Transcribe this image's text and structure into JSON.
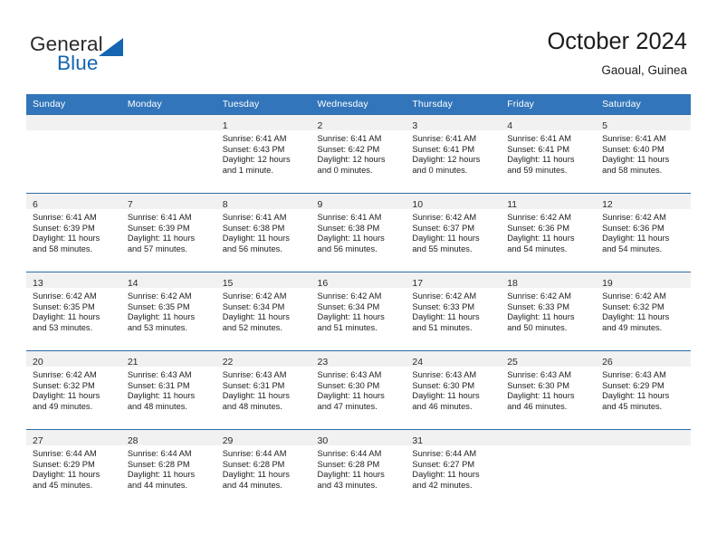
{
  "brand": {
    "name_part1": "General",
    "name_part2": "Blue",
    "accent_color": "#1565b0"
  },
  "header": {
    "title": "October 2024",
    "subtitle": "Gaoual, Guinea"
  },
  "calendar": {
    "header_bg": "#3275ba",
    "row_divider_color": "#2e6da4",
    "daynum_band_bg": "#f1f1f1",
    "weekday_headers": [
      "Sunday",
      "Monday",
      "Tuesday",
      "Wednesday",
      "Thursday",
      "Friday",
      "Saturday"
    ],
    "weeks": [
      [
        {
          "day": "",
          "empty": true
        },
        {
          "day": "",
          "empty": true
        },
        {
          "day": "1",
          "sunrise": "Sunrise: 6:41 AM",
          "sunset": "Sunset: 6:43 PM",
          "daylight_line1": "Daylight: 12 hours",
          "daylight_line2": "and 1 minute."
        },
        {
          "day": "2",
          "sunrise": "Sunrise: 6:41 AM",
          "sunset": "Sunset: 6:42 PM",
          "daylight_line1": "Daylight: 12 hours",
          "daylight_line2": "and 0 minutes."
        },
        {
          "day": "3",
          "sunrise": "Sunrise: 6:41 AM",
          "sunset": "Sunset: 6:41 PM",
          "daylight_line1": "Daylight: 12 hours",
          "daylight_line2": "and 0 minutes."
        },
        {
          "day": "4",
          "sunrise": "Sunrise: 6:41 AM",
          "sunset": "Sunset: 6:41 PM",
          "daylight_line1": "Daylight: 11 hours",
          "daylight_line2": "and 59 minutes."
        },
        {
          "day": "5",
          "sunrise": "Sunrise: 6:41 AM",
          "sunset": "Sunset: 6:40 PM",
          "daylight_line1": "Daylight: 11 hours",
          "daylight_line2": "and 58 minutes."
        }
      ],
      [
        {
          "day": "6",
          "sunrise": "Sunrise: 6:41 AM",
          "sunset": "Sunset: 6:39 PM",
          "daylight_line1": "Daylight: 11 hours",
          "daylight_line2": "and 58 minutes."
        },
        {
          "day": "7",
          "sunrise": "Sunrise: 6:41 AM",
          "sunset": "Sunset: 6:39 PM",
          "daylight_line1": "Daylight: 11 hours",
          "daylight_line2": "and 57 minutes."
        },
        {
          "day": "8",
          "sunrise": "Sunrise: 6:41 AM",
          "sunset": "Sunset: 6:38 PM",
          "daylight_line1": "Daylight: 11 hours",
          "daylight_line2": "and 56 minutes."
        },
        {
          "day": "9",
          "sunrise": "Sunrise: 6:41 AM",
          "sunset": "Sunset: 6:38 PM",
          "daylight_line1": "Daylight: 11 hours",
          "daylight_line2": "and 56 minutes."
        },
        {
          "day": "10",
          "sunrise": "Sunrise: 6:42 AM",
          "sunset": "Sunset: 6:37 PM",
          "daylight_line1": "Daylight: 11 hours",
          "daylight_line2": "and 55 minutes."
        },
        {
          "day": "11",
          "sunrise": "Sunrise: 6:42 AM",
          "sunset": "Sunset: 6:36 PM",
          "daylight_line1": "Daylight: 11 hours",
          "daylight_line2": "and 54 minutes."
        },
        {
          "day": "12",
          "sunrise": "Sunrise: 6:42 AM",
          "sunset": "Sunset: 6:36 PM",
          "daylight_line1": "Daylight: 11 hours",
          "daylight_line2": "and 54 minutes."
        }
      ],
      [
        {
          "day": "13",
          "sunrise": "Sunrise: 6:42 AM",
          "sunset": "Sunset: 6:35 PM",
          "daylight_line1": "Daylight: 11 hours",
          "daylight_line2": "and 53 minutes."
        },
        {
          "day": "14",
          "sunrise": "Sunrise: 6:42 AM",
          "sunset": "Sunset: 6:35 PM",
          "daylight_line1": "Daylight: 11 hours",
          "daylight_line2": "and 53 minutes."
        },
        {
          "day": "15",
          "sunrise": "Sunrise: 6:42 AM",
          "sunset": "Sunset: 6:34 PM",
          "daylight_line1": "Daylight: 11 hours",
          "daylight_line2": "and 52 minutes."
        },
        {
          "day": "16",
          "sunrise": "Sunrise: 6:42 AM",
          "sunset": "Sunset: 6:34 PM",
          "daylight_line1": "Daylight: 11 hours",
          "daylight_line2": "and 51 minutes."
        },
        {
          "day": "17",
          "sunrise": "Sunrise: 6:42 AM",
          "sunset": "Sunset: 6:33 PM",
          "daylight_line1": "Daylight: 11 hours",
          "daylight_line2": "and 51 minutes."
        },
        {
          "day": "18",
          "sunrise": "Sunrise: 6:42 AM",
          "sunset": "Sunset: 6:33 PM",
          "daylight_line1": "Daylight: 11 hours",
          "daylight_line2": "and 50 minutes."
        },
        {
          "day": "19",
          "sunrise": "Sunrise: 6:42 AM",
          "sunset": "Sunset: 6:32 PM",
          "daylight_line1": "Daylight: 11 hours",
          "daylight_line2": "and 49 minutes."
        }
      ],
      [
        {
          "day": "20",
          "sunrise": "Sunrise: 6:42 AM",
          "sunset": "Sunset: 6:32 PM",
          "daylight_line1": "Daylight: 11 hours",
          "daylight_line2": "and 49 minutes."
        },
        {
          "day": "21",
          "sunrise": "Sunrise: 6:43 AM",
          "sunset": "Sunset: 6:31 PM",
          "daylight_line1": "Daylight: 11 hours",
          "daylight_line2": "and 48 minutes."
        },
        {
          "day": "22",
          "sunrise": "Sunrise: 6:43 AM",
          "sunset": "Sunset: 6:31 PM",
          "daylight_line1": "Daylight: 11 hours",
          "daylight_line2": "and 48 minutes."
        },
        {
          "day": "23",
          "sunrise": "Sunrise: 6:43 AM",
          "sunset": "Sunset: 6:30 PM",
          "daylight_line1": "Daylight: 11 hours",
          "daylight_line2": "and 47 minutes."
        },
        {
          "day": "24",
          "sunrise": "Sunrise: 6:43 AM",
          "sunset": "Sunset: 6:30 PM",
          "daylight_line1": "Daylight: 11 hours",
          "daylight_line2": "and 46 minutes."
        },
        {
          "day": "25",
          "sunrise": "Sunrise: 6:43 AM",
          "sunset": "Sunset: 6:30 PM",
          "daylight_line1": "Daylight: 11 hours",
          "daylight_line2": "and 46 minutes."
        },
        {
          "day": "26",
          "sunrise": "Sunrise: 6:43 AM",
          "sunset": "Sunset: 6:29 PM",
          "daylight_line1": "Daylight: 11 hours",
          "daylight_line2": "and 45 minutes."
        }
      ],
      [
        {
          "day": "27",
          "sunrise": "Sunrise: 6:44 AM",
          "sunset": "Sunset: 6:29 PM",
          "daylight_line1": "Daylight: 11 hours",
          "daylight_line2": "and 45 minutes."
        },
        {
          "day": "28",
          "sunrise": "Sunrise: 6:44 AM",
          "sunset": "Sunset: 6:28 PM",
          "daylight_line1": "Daylight: 11 hours",
          "daylight_line2": "and 44 minutes."
        },
        {
          "day": "29",
          "sunrise": "Sunrise: 6:44 AM",
          "sunset": "Sunset: 6:28 PM",
          "daylight_line1": "Daylight: 11 hours",
          "daylight_line2": "and 44 minutes."
        },
        {
          "day": "30",
          "sunrise": "Sunrise: 6:44 AM",
          "sunset": "Sunset: 6:28 PM",
          "daylight_line1": "Daylight: 11 hours",
          "daylight_line2": "and 43 minutes."
        },
        {
          "day": "31",
          "sunrise": "Sunrise: 6:44 AM",
          "sunset": "Sunset: 6:27 PM",
          "daylight_line1": "Daylight: 11 hours",
          "daylight_line2": "and 42 minutes."
        },
        {
          "day": "",
          "empty": true
        },
        {
          "day": "",
          "empty": true
        }
      ]
    ]
  }
}
